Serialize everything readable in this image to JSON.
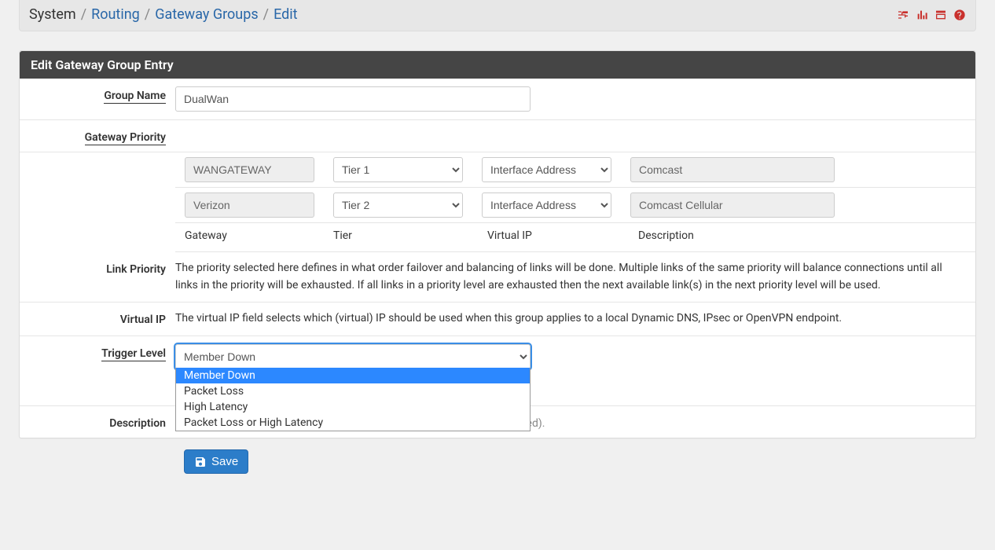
{
  "breadcrumb": {
    "seg1": "System",
    "seg2": "Routing",
    "seg3": "Gateway Groups",
    "seg4": "Edit"
  },
  "panel_title": "Edit Gateway Group Entry",
  "labels": {
    "group_name": "Group Name",
    "gateway_priority": "Gateway Priority",
    "link_priority": "Link Priority",
    "virtual_ip": "Virtual IP",
    "trigger_level": "Trigger Level",
    "description": "Description"
  },
  "group_name_value": "DualWan",
  "gateway_rows": [
    {
      "gateway": "WANGATEWAY",
      "tier": "Tier 1",
      "virtual_ip": "Interface Address",
      "description": "Comcast"
    },
    {
      "gateway": "Verizon",
      "tier": "Tier 2",
      "virtual_ip": "Interface Address",
      "description": "Comcast Cellular"
    }
  ],
  "col_headers": {
    "gateway": "Gateway",
    "tier": "Tier",
    "virtual_ip": "Virtual IP",
    "description": "Description"
  },
  "help": {
    "link_priority": "The priority selected here defines in what order failover and balancing of links will be done. Multiple links of the same priority will balance connections until all links in the priority will be exhausted. If all links in a priority level are exhausted then the next available link(s) in the next priority level will be used.",
    "virtual_ip": "The virtual IP field selects which (virtual) IP should be used when this group applies to a local Dynamic DNS, IPsec or OpenVPN endpoint.",
    "description_note": "A description may be entered here for administrative reference (not parsed)."
  },
  "trigger": {
    "selected": "Member Down",
    "options": [
      "Member Down",
      "Packet Loss",
      "High Latency",
      "Packet Loss or High Latency"
    ]
  },
  "save_label": "Save"
}
